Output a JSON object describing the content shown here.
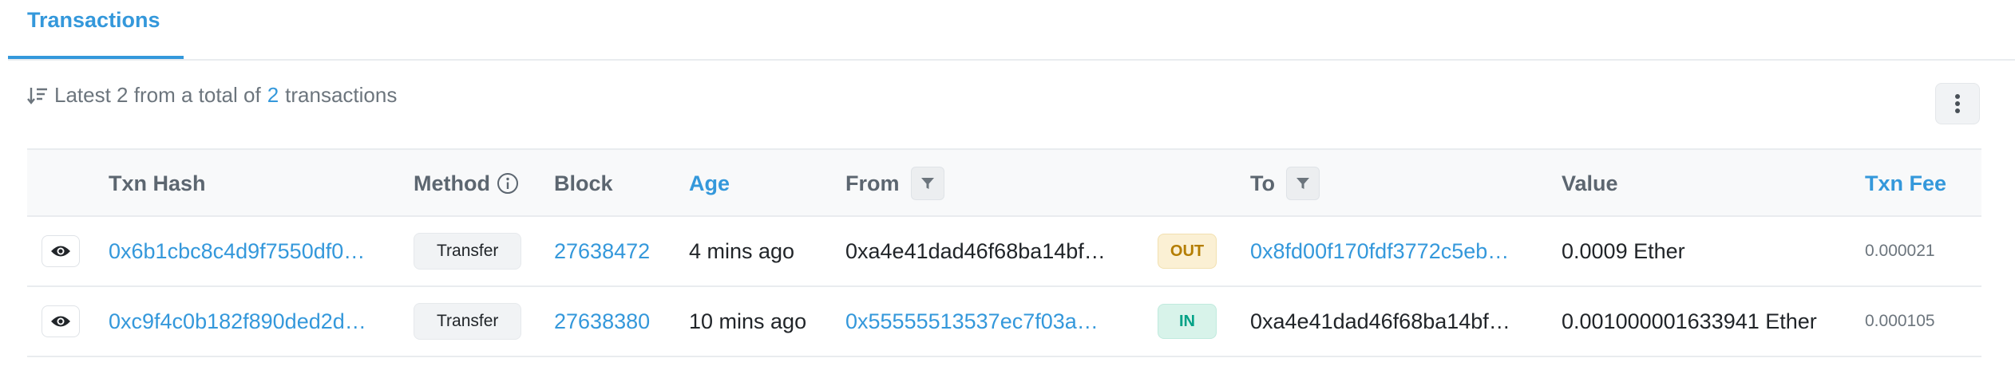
{
  "tabs": {
    "active": "Transactions"
  },
  "summary": {
    "prefix": "Latest 2 from a total of",
    "count": "2",
    "suffix": "transactions"
  },
  "table": {
    "headers": {
      "txn_hash": "Txn Hash",
      "method": "Method",
      "block": "Block",
      "age": "Age",
      "from": "From",
      "to": "To",
      "value": "Value",
      "txn_fee": "Txn Fee"
    },
    "rows": [
      {
        "hash": "0x6b1cbc8c4d9f7550df0…",
        "method": "Transfer",
        "block": "27638472",
        "age": "4 mins ago",
        "from": "0xa4e41dad46f68ba14bf…",
        "direction": "OUT",
        "to": "0x8fd00f170fdf3772c5eb…",
        "value": "0.0009 Ether",
        "fee": "0.000021"
      },
      {
        "hash": "0xc9f4c0b182f890ded2d…",
        "method": "Transfer",
        "block": "27638380",
        "age": "10 mins ago",
        "from": "0x55555513537ec7f03a…",
        "direction": "IN",
        "to": "0xa4e41dad46f68ba14bf…",
        "value": "0.001000001633941 Ether",
        "fee": "0.000105"
      }
    ]
  },
  "colors": {
    "link": "#3498db",
    "out_badge": "#fbf0d4",
    "in_badge": "#d8f3ea"
  },
  "icons": [
    "sort-desc-icon",
    "more-vertical-icon",
    "info-icon",
    "filter-icon",
    "eye-icon"
  ]
}
